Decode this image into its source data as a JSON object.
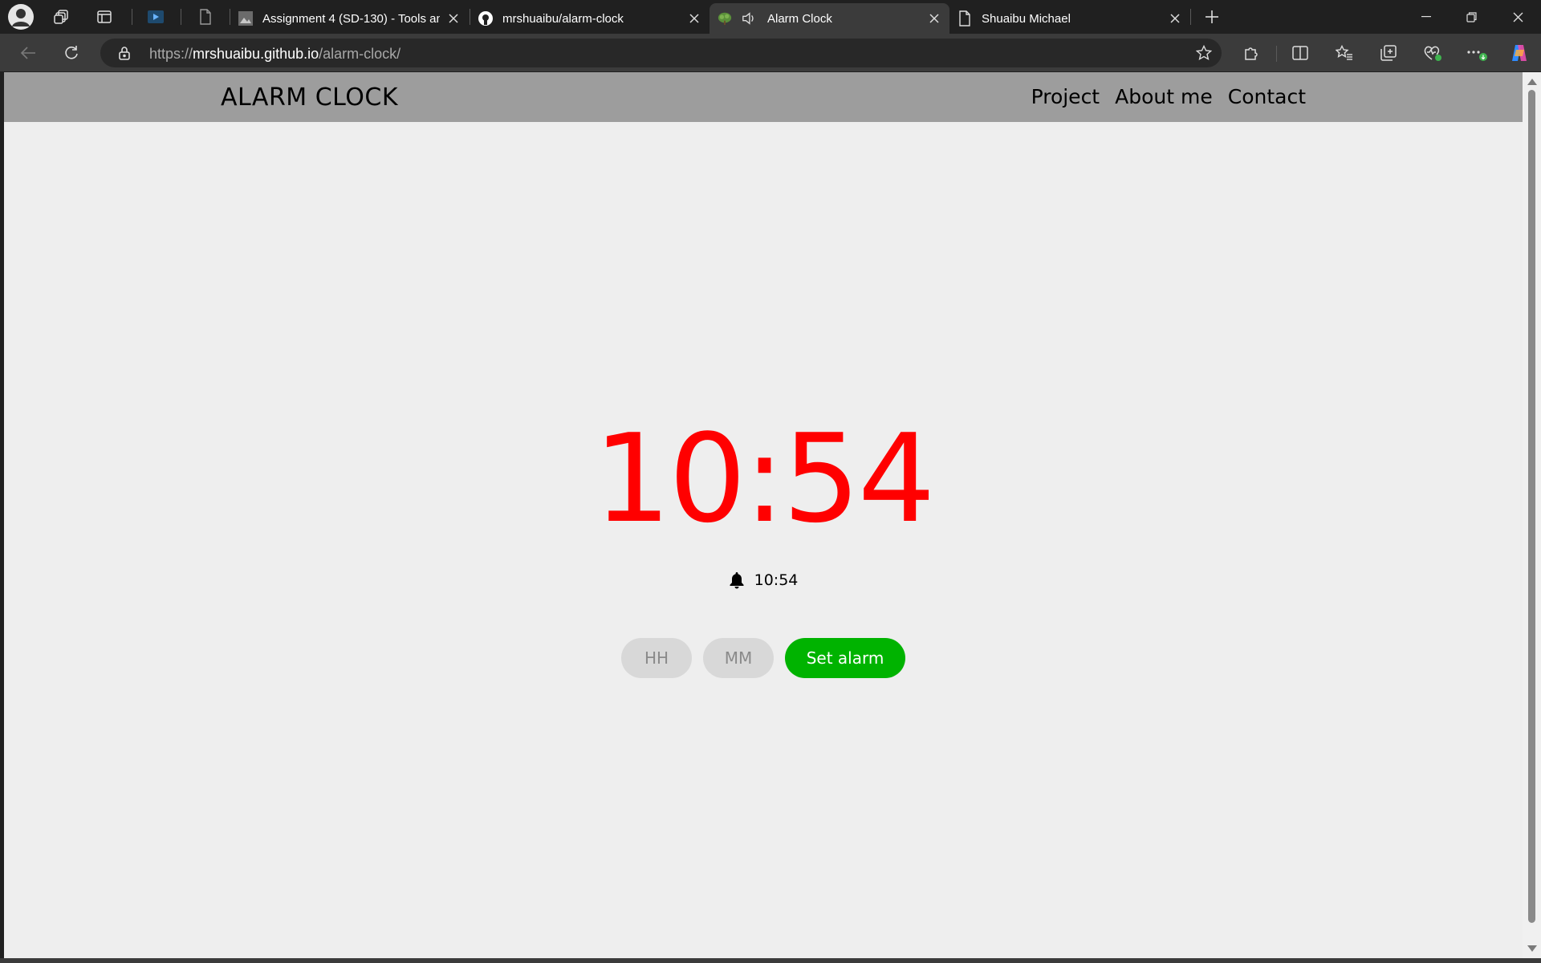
{
  "browser": {
    "tabs": [
      {
        "title": "Assignment 4 (SD-130) - Tools and",
        "favicon": "image-icon"
      },
      {
        "title": "mrshuaibu/alarm-clock",
        "favicon": "github-icon"
      },
      {
        "title": "Alarm Clock",
        "favicon": "tree-icon",
        "audio": "speaker-icon"
      },
      {
        "title": "Shuaibu Michael",
        "favicon": "document-icon"
      }
    ],
    "url_prefix": "https://",
    "url_host": "mrshuaibu.github.io",
    "url_path": "/alarm-clock/"
  },
  "site": {
    "brand": "ALARM CLOCK",
    "nav": [
      "Project",
      "About me",
      "Contact"
    ]
  },
  "clock": {
    "time": "10:54",
    "alarm_time": "10:54",
    "hour_placeholder": "HH",
    "minute_placeholder": "MM",
    "set_label": "Set alarm"
  },
  "colors": {
    "clock": "#ff0000",
    "header": "#9d9d9d",
    "background": "#eeeeee",
    "button": "#00b300"
  }
}
